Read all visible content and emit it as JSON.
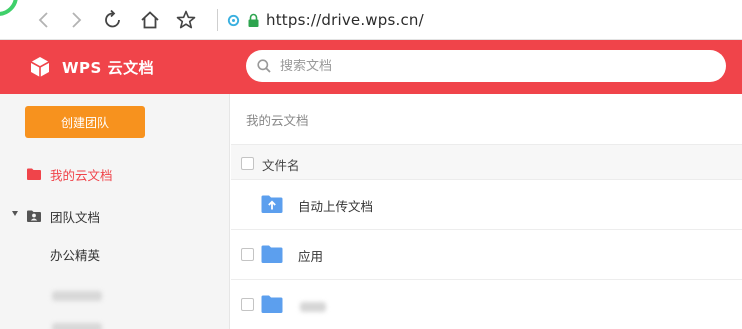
{
  "browser": {
    "url": "https://drive.wps.cn/",
    "icons": [
      "back-icon",
      "forward-icon",
      "reload-icon",
      "home-icon",
      "star-icon",
      "extension-icon",
      "lock-icon"
    ]
  },
  "header": {
    "brand": "WPS 云文档",
    "search_placeholder": "搜索文档",
    "color": "#f0444a"
  },
  "sidebar": {
    "create_button": "创建团队",
    "items": [
      {
        "label": "我的云文档",
        "icon": "folder-icon",
        "active": true
      },
      {
        "label": "团队文档",
        "icon": "team-folder-icon",
        "expanded": true
      }
    ],
    "subitems": [
      {
        "label": "办公精英"
      }
    ],
    "accent": "#f7921e"
  },
  "content": {
    "breadcrumb": "我的云文档",
    "column_header": "文件名",
    "rows": [
      {
        "name": "自动上传文档",
        "icon": "upload-folder-icon"
      },
      {
        "name": "应用",
        "icon": "folder-icon"
      }
    ]
  }
}
